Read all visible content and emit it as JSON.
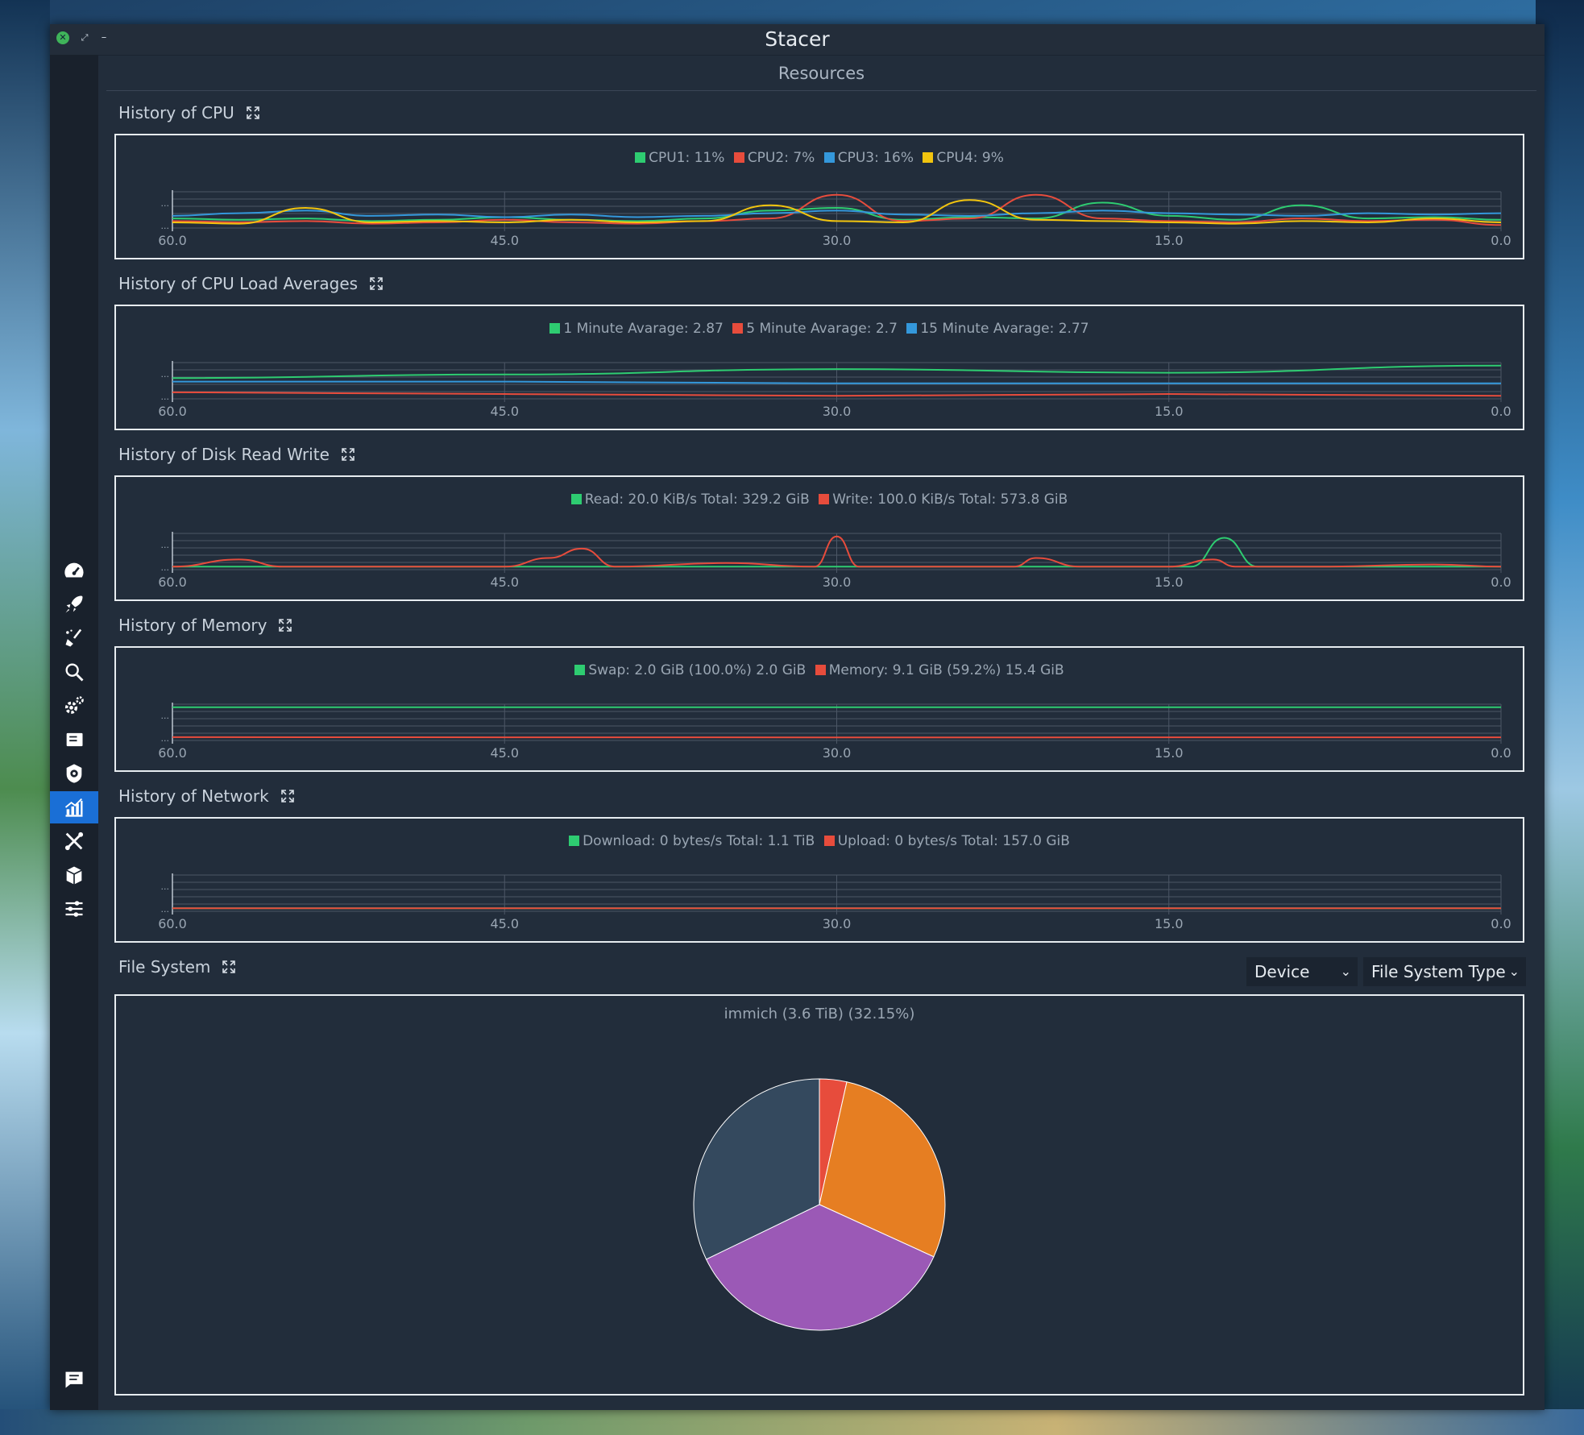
{
  "window": {
    "title": "Stacer"
  },
  "page": {
    "title": "Resources"
  },
  "sidebar": {
    "items": [
      {
        "icon": "dashboard-icon"
      },
      {
        "icon": "startup-rocket-icon"
      },
      {
        "icon": "system-cleaner-broom-icon"
      },
      {
        "icon": "search-icon"
      },
      {
        "icon": "services-gears-icon"
      },
      {
        "icon": "processes-icon"
      },
      {
        "icon": "uninstaller-icon"
      },
      {
        "icon": "resources-chart-icon",
        "active": true
      },
      {
        "icon": "helpers-tools-icon"
      },
      {
        "icon": "apt-repository-box-icon"
      },
      {
        "icon": "settings-sliders-icon"
      }
    ],
    "feedback_icon": "feedback-message-icon"
  },
  "colors": {
    "green": "#2ecc71",
    "red": "#e74c3c",
    "blue": "#3498db",
    "yellow": "#f1c40f",
    "orange": "#e67e22",
    "purple": "#9b59b6",
    "slate": "#34495e",
    "accent": "#1a6fd6"
  },
  "sections": {
    "cpu": {
      "title": "History of CPU",
      "legend": [
        "CPU1: 11%",
        "CPU2: 7%",
        "CPU3: 16%",
        "CPU4: 9%"
      ]
    },
    "load": {
      "title": "History of CPU Load Averages",
      "legend": [
        "1 Minute Avarage: 2.87",
        "5 Minute Avarage: 2.7",
        "15 Minute Avarage: 2.77"
      ]
    },
    "disk": {
      "title": "History of Disk Read Write",
      "legend": [
        "Read: 20.0 KiB/s Total: 329.2 GiB",
        "Write: 100.0 KiB/s Total: 573.8 GiB"
      ]
    },
    "memory": {
      "title": "History of Memory",
      "legend": [
        "Swap: 2.0 GiB (100.0%) 2.0 GiB",
        "Memory: 9.1 GiB (59.2%) 15.4 GiB"
      ]
    },
    "network": {
      "title": "History of Network",
      "legend": [
        "Download: 0 bytes/s Total: 1.1 TiB",
        "Upload: 0 bytes/s Total: 157.0 GiB"
      ]
    },
    "filesystem": {
      "title": "File System",
      "device_select": "Device",
      "fstype_select": "File System Type",
      "pie_title": "immich (3.6 TiB) (32.15%)"
    }
  },
  "chart_data": [
    {
      "type": "line",
      "id": "cpu",
      "x_ticks": [
        "60.0",
        "45.0",
        "30.0",
        "15.0",
        "0.0"
      ],
      "y_ticks": [
        "...",
        "..."
      ],
      "xlim": [
        60,
        0
      ],
      "series": [
        {
          "name": "CPU1",
          "color": "#2ecc71",
          "x": [
            60,
            57,
            54,
            51,
            48,
            45,
            42,
            39,
            36,
            33,
            30,
            27,
            24,
            21,
            18,
            15,
            12,
            9,
            6,
            3,
            0
          ],
          "y": [
            12,
            11,
            12,
            10,
            11,
            13,
            11,
            10,
            12,
            18,
            20,
            11,
            13,
            12,
            24,
            14,
            11,
            22,
            12,
            13,
            11
          ]
        },
        {
          "name": "CPU2",
          "color": "#e74c3c",
          "x": [
            60,
            57,
            54,
            51,
            48,
            45,
            42,
            39,
            36,
            33,
            30,
            27,
            24,
            21,
            18,
            15,
            12,
            9,
            6,
            3,
            0
          ],
          "y": [
            10,
            9,
            10,
            8,
            9,
            11,
            9,
            8,
            10,
            12,
            30,
            10,
            12,
            30,
            12,
            10,
            9,
            12,
            10,
            11,
            7
          ]
        },
        {
          "name": "CPU3",
          "color": "#3498db",
          "x": [
            60,
            57,
            54,
            51,
            48,
            45,
            42,
            39,
            36,
            33,
            30,
            27,
            24,
            21,
            18,
            15,
            12,
            9,
            6,
            3,
            0
          ],
          "y": [
            14,
            16,
            18,
            14,
            15,
            13,
            15,
            13,
            14,
            16,
            18,
            15,
            14,
            16,
            18,
            16,
            15,
            14,
            16,
            15,
            16
          ]
        },
        {
          "name": "CPU4",
          "color": "#f1c40f",
          "x": [
            60,
            57,
            54,
            51,
            48,
            45,
            42,
            39,
            36,
            33,
            30,
            27,
            24,
            21,
            18,
            15,
            12,
            9,
            6,
            3,
            0
          ],
          "y": [
            9,
            8,
            20,
            9,
            10,
            9,
            11,
            9,
            10,
            22,
            10,
            9,
            26,
            11,
            10,
            9,
            8,
            10,
            9,
            12,
            9
          ]
        }
      ]
    },
    {
      "type": "line",
      "id": "load",
      "x_ticks": [
        "60.0",
        "45.0",
        "30.0",
        "15.0",
        "0.0"
      ],
      "y_ticks": [
        "...",
        "..."
      ],
      "xlim": [
        60,
        0
      ],
      "series": [
        {
          "name": "1 Minute Avarage",
          "color": "#2ecc71",
          "x": [
            60,
            45,
            30,
            15,
            0
          ],
          "y": [
            2.8,
            2.82,
            2.85,
            2.83,
            2.87
          ]
        },
        {
          "name": "5 Minute Avarage",
          "color": "#e74c3c",
          "x": [
            60,
            45,
            30,
            15,
            0
          ],
          "y": [
            2.72,
            2.71,
            2.7,
            2.71,
            2.7
          ]
        },
        {
          "name": "15 Minute Avarage",
          "color": "#3498db",
          "x": [
            60,
            45,
            30,
            15,
            0
          ],
          "y": [
            2.78,
            2.78,
            2.77,
            2.77,
            2.77
          ]
        }
      ]
    },
    {
      "type": "line",
      "id": "disk",
      "x_ticks": [
        "60.0",
        "45.0",
        "30.0",
        "15.0",
        "0.0"
      ],
      "y_ticks": [
        "...",
        "..."
      ],
      "xlim": [
        60,
        0
      ],
      "series": [
        {
          "name": "Read",
          "color": "#2ecc71",
          "x": [
            60,
            50,
            40,
            30,
            20,
            14,
            12.5,
            11,
            5,
            0
          ],
          "y": [
            0,
            0,
            0,
            0,
            0,
            0,
            40,
            0,
            0,
            0
          ]
        },
        {
          "name": "Write",
          "color": "#e74c3c",
          "x": [
            60,
            57,
            55,
            53,
            47,
            45,
            43,
            41.5,
            40,
            35,
            31,
            30,
            29,
            27,
            22,
            21,
            19,
            15,
            13,
            12,
            8,
            3,
            0
          ],
          "y": [
            0,
            10,
            0,
            0,
            0,
            0,
            12,
            25,
            0,
            5,
            0,
            42,
            0,
            0,
            0,
            12,
            0,
            0,
            10,
            0,
            0,
            3,
            0
          ]
        }
      ]
    },
    {
      "type": "line",
      "id": "memory",
      "x_ticks": [
        "60.0",
        "45.0",
        "30.0",
        "15.0",
        "0.0"
      ],
      "y_ticks": [
        "...",
        "..."
      ],
      "xlim": [
        60,
        0
      ],
      "series": [
        {
          "name": "Swap",
          "color": "#2ecc71",
          "x": [
            60,
            0
          ],
          "y": [
            100,
            100
          ]
        },
        {
          "name": "Memory",
          "color": "#e74c3c",
          "x": [
            60,
            30,
            0
          ],
          "y": [
            59.4,
            59.0,
            59.2
          ]
        }
      ]
    },
    {
      "type": "line",
      "id": "network",
      "x_ticks": [
        "60.0",
        "45.0",
        "30.0",
        "15.0",
        "0.0"
      ],
      "y_ticks": [
        "...",
        "..."
      ],
      "xlim": [
        60,
        0
      ],
      "series": [
        {
          "name": "Download",
          "color": "#2ecc71",
          "x": [
            60,
            0
          ],
          "y": [
            0,
            0
          ]
        },
        {
          "name": "Upload",
          "color": "#e74c3c",
          "x": [
            60,
            0
          ],
          "y": [
            0,
            0
          ]
        }
      ]
    },
    {
      "type": "pie",
      "id": "filesystem",
      "title": "immich (3.6 TiB) (32.15%)",
      "slices": [
        {
          "value": 3.5,
          "color": "#e74c3c"
        },
        {
          "value": 28.3,
          "color": "#e67e22"
        },
        {
          "value": 36.0,
          "color": "#9b59b6"
        },
        {
          "value": 32.15,
          "color": "#34495e"
        }
      ]
    }
  ]
}
